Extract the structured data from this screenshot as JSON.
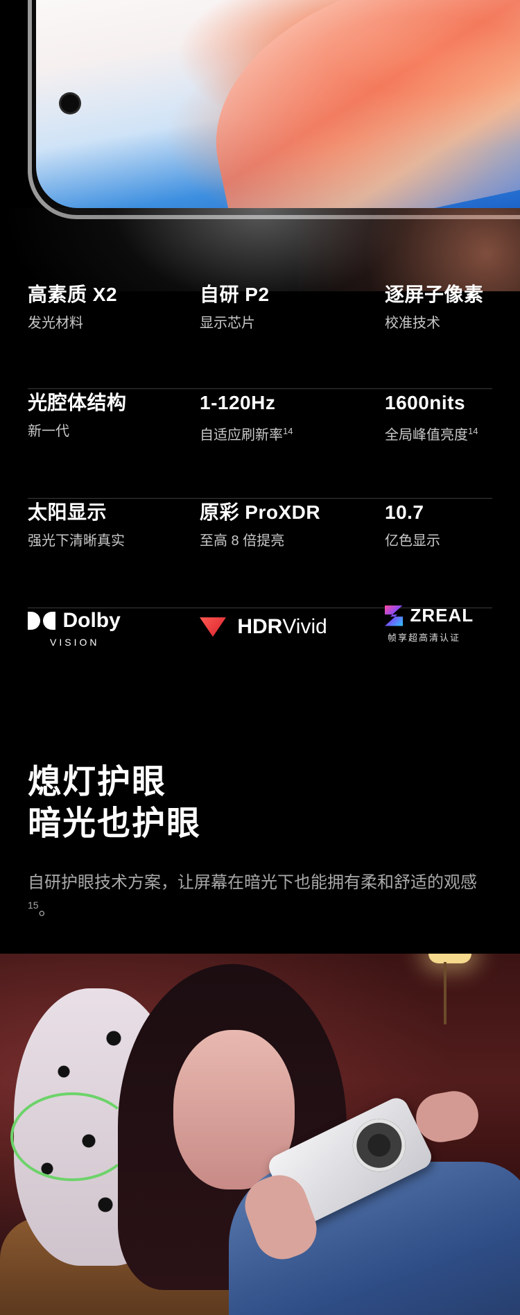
{
  "specs": [
    [
      {
        "title": "高素质 X2",
        "subtitle": "发光材料",
        "sup": ""
      },
      {
        "title": "自研 P2",
        "subtitle": "显示芯片",
        "sup": ""
      },
      {
        "title": "逐屏子像素",
        "subtitle": "校准技术",
        "sup": ""
      }
    ],
    [
      {
        "title": "光腔体结构",
        "subtitle": "新一代",
        "sup": ""
      },
      {
        "title": "1-120Hz",
        "subtitle": "自适应刷新率",
        "sup": "14"
      },
      {
        "title": "1600nits",
        "subtitle": "全局峰值亮度",
        "sup": "14"
      }
    ],
    [
      {
        "title": "太阳显示",
        "subtitle": "强光下清晰真实",
        "sup": ""
      },
      {
        "title": "原彩 ProXDR",
        "subtitle": "至高 8 倍提亮",
        "sup": ""
      },
      {
        "title": "10.7",
        "subtitle": "亿色显示",
        "sup": ""
      }
    ]
  ],
  "logos": {
    "dolby_word": "Dolby",
    "dolby_sub": "VISION",
    "hdr_bold": "HDR",
    "hdr_light": "Vivid",
    "zreal_word": "ZREAL",
    "zreal_sub": "帧享超高清认证"
  },
  "headline": {
    "line1": "熄灯护眼",
    "line2": "暗光也护眼",
    "body": "自研护眼技术方案，让屏幕在暗光下也能拥有柔和舒适的观感",
    "body_sup": "15",
    "body_end": "。"
  },
  "icons": [
    "dolby-logo-icon",
    "hdr-vivid-flag-icon",
    "zreal-logo-icon"
  ],
  "colors": {
    "background": "#000000",
    "subtitle": "#c9c9c9",
    "body": "#a9a9a9",
    "divider": "#3a3a3a"
  }
}
